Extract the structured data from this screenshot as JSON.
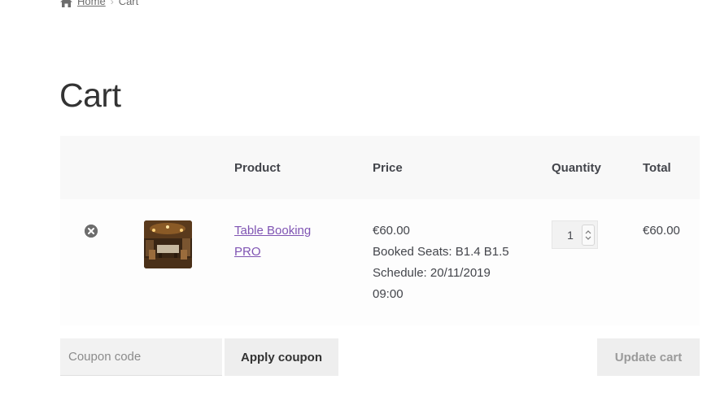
{
  "breadcrumb": {
    "home_label": "Home",
    "separator": "›",
    "current": "Cart",
    "home_icon": "home-icon"
  },
  "page": {
    "title": "Cart"
  },
  "table": {
    "headers": {
      "remove": "",
      "thumbnail": "",
      "product": "Product",
      "price": "Price",
      "quantity": "Quantity",
      "total": "Total"
    },
    "items": [
      {
        "remove_icon": "remove-circle-icon",
        "product_name_line1": "Table Booking",
        "product_name_line2": "PRO",
        "price": "€60.00",
        "meta_seats": "Booked Seats: B1.4 B1.5",
        "meta_schedule_line1": "Schedule: 20/11/2019",
        "meta_schedule_line2": "09:00",
        "quantity": "1",
        "total": "€60.00"
      }
    ]
  },
  "actions": {
    "coupon_placeholder": "Coupon code",
    "apply_coupon_label": "Apply coupon",
    "update_cart_label": "Update cart"
  },
  "colors": {
    "link": "#7f54b3",
    "header_bg": "#f8f8f8",
    "button_bg": "#eeeeee"
  }
}
